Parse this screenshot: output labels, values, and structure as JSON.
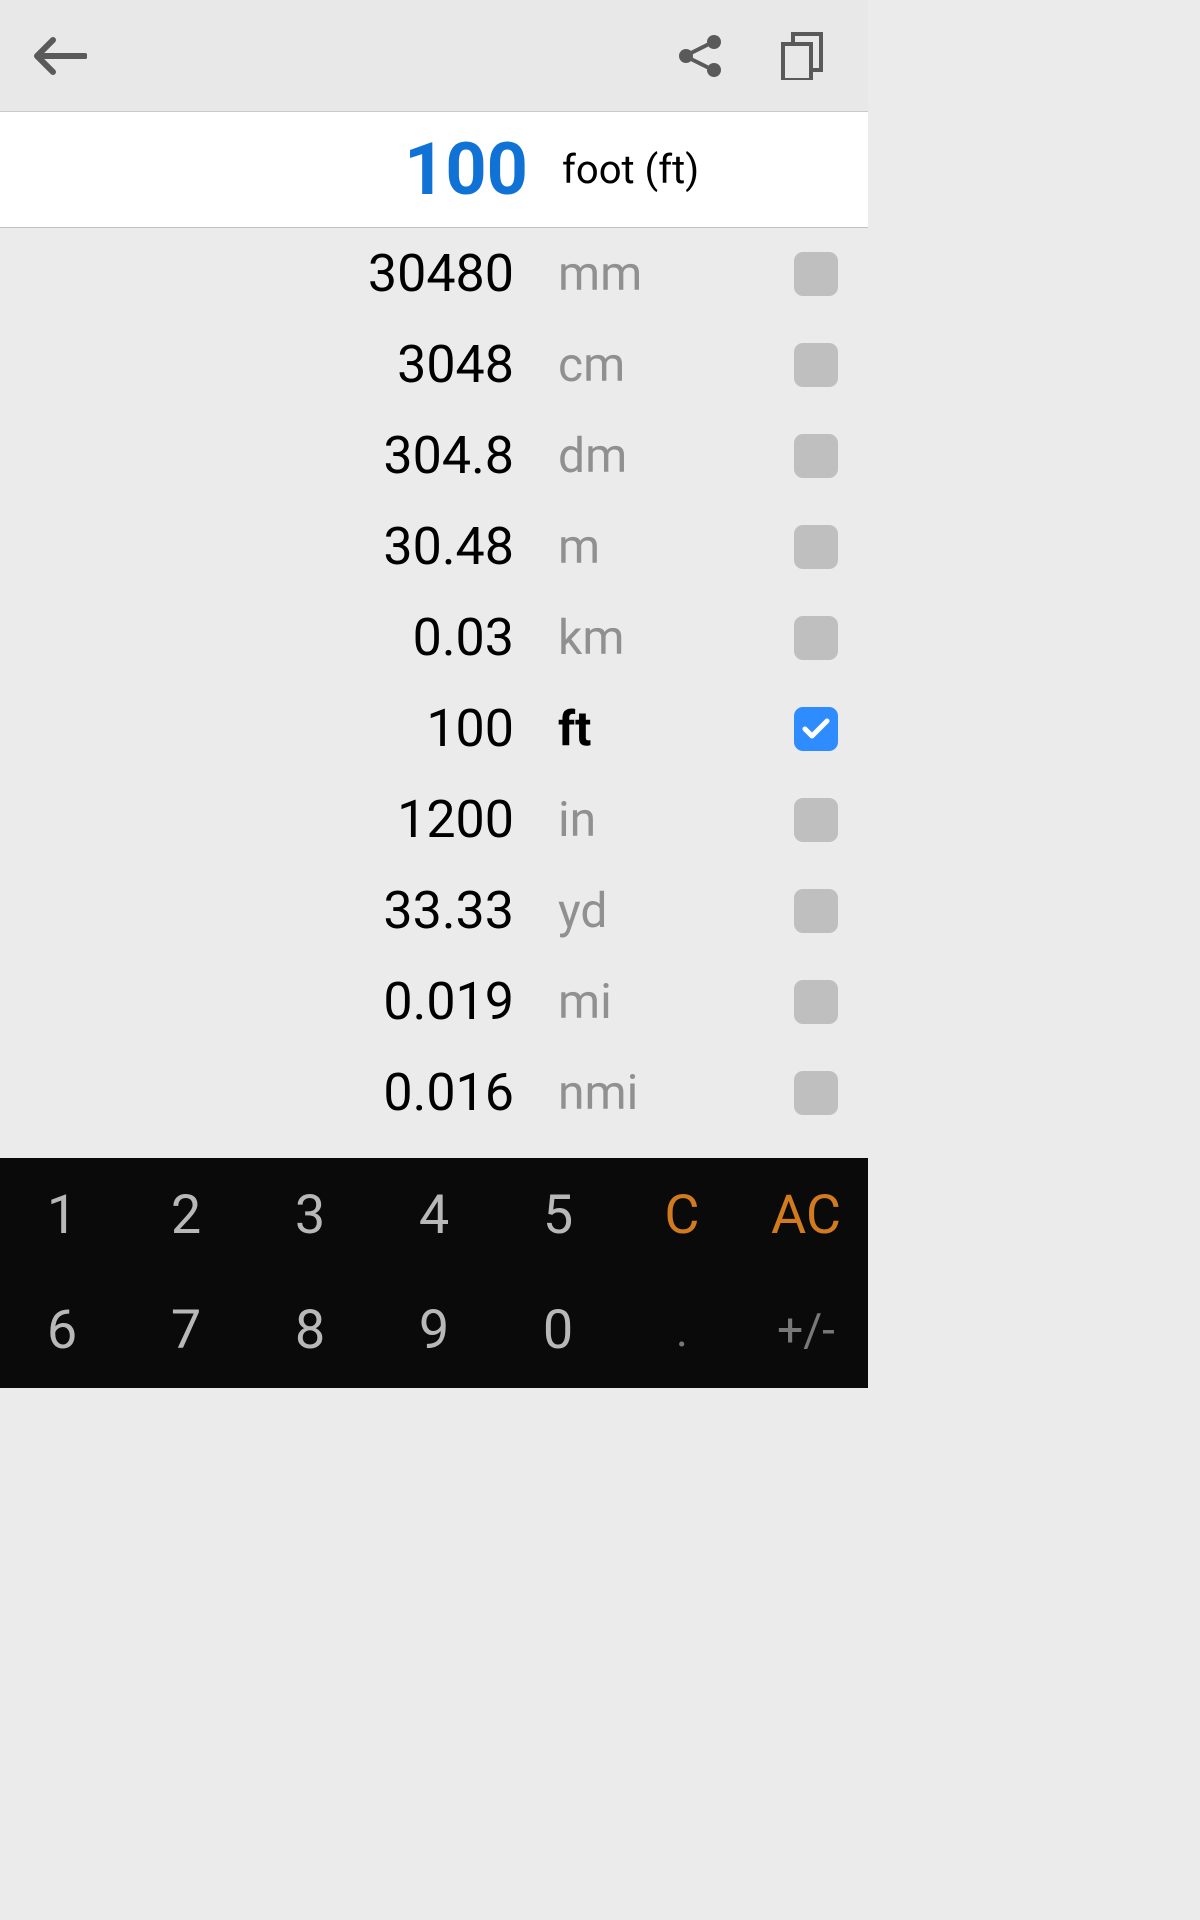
{
  "input": {
    "value": "100",
    "unit_label": "foot (ft)"
  },
  "results": [
    {
      "value": "30480",
      "unit": "mm",
      "selected": false
    },
    {
      "value": "3048",
      "unit": "cm",
      "selected": false
    },
    {
      "value": "304.8",
      "unit": "dm",
      "selected": false
    },
    {
      "value": "30.48",
      "unit": "m",
      "selected": false
    },
    {
      "value": "0.03",
      "unit": "km",
      "selected": false
    },
    {
      "value": "100",
      "unit": "ft",
      "selected": true
    },
    {
      "value": "1200",
      "unit": "in",
      "selected": false
    },
    {
      "value": "33.33",
      "unit": "yd",
      "selected": false
    },
    {
      "value": "0.019",
      "unit": "mi",
      "selected": false
    },
    {
      "value": "0.016",
      "unit": "nmi",
      "selected": false
    }
  ],
  "keypad": {
    "keys": [
      {
        "label": "1",
        "type": "digit"
      },
      {
        "label": "2",
        "type": "digit"
      },
      {
        "label": "3",
        "type": "digit"
      },
      {
        "label": "4",
        "type": "digit"
      },
      {
        "label": "5",
        "type": "digit"
      },
      {
        "label": "C",
        "type": "accent"
      },
      {
        "label": "AC",
        "type": "accent"
      },
      {
        "label": "6",
        "type": "digit"
      },
      {
        "label": "7",
        "type": "digit"
      },
      {
        "label": "8",
        "type": "digit"
      },
      {
        "label": "9",
        "type": "digit"
      },
      {
        "label": "0",
        "type": "digit"
      },
      {
        "label": ".",
        "type": "dim"
      },
      {
        "label": "+/-",
        "type": "dim"
      }
    ]
  }
}
